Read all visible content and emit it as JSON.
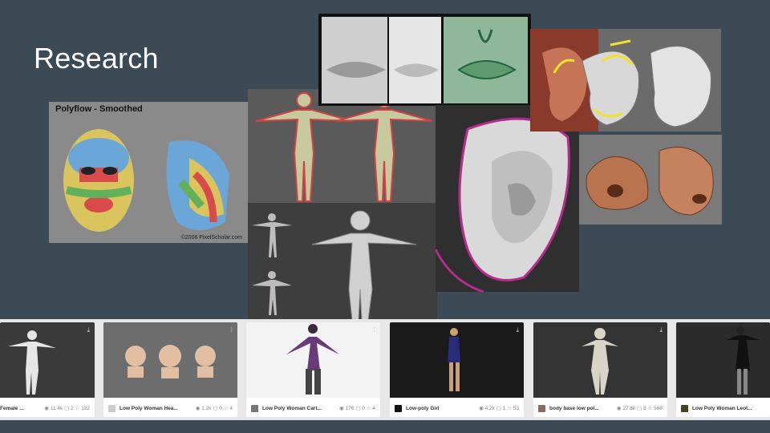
{
  "slide": {
    "title": "Research"
  },
  "face_panel": {
    "caption": "Polyflow - Smoothed",
    "credit": "©2008 PixelScholar.com"
  },
  "gallery": {
    "cards": [
      {
        "name": "Female ...",
        "views": "11.4k",
        "comments": "2",
        "likes": "122",
        "thumb_color": "#3a3a3a"
      },
      {
        "name": "Low Poly Woman Hea...",
        "views": "1.2k",
        "comments": "0",
        "likes": "4",
        "thumb_color": "#6d6d6d"
      },
      {
        "name": "Low Poly Woman Cart...",
        "views": "176",
        "comments": "0",
        "likes": "4",
        "thumb_color": "#f3f3f3"
      },
      {
        "name": "Low-poly Girl",
        "views": "4.2k",
        "comments": "1",
        "likes": "53",
        "thumb_color": "#1a1a1a"
      },
      {
        "name": "body base low pol...",
        "views": "27.6k",
        "comments": "8",
        "likes": "568",
        "thumb_color": "#333"
      },
      {
        "name": "Low Poly Woman Leot...",
        "views": "",
        "comments": "",
        "likes": "",
        "thumb_color": "#2b2b2b"
      }
    ]
  }
}
